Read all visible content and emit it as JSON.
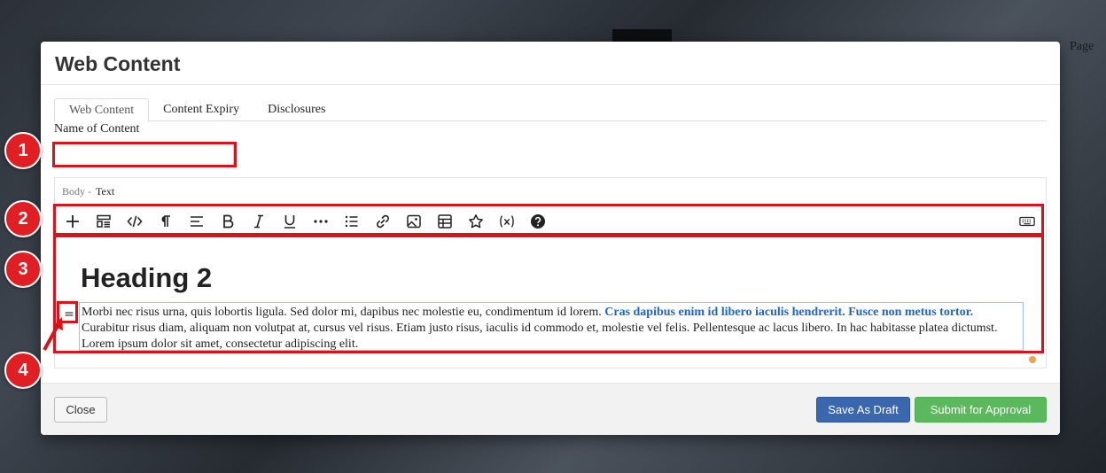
{
  "background": {
    "page_link_text": "Page"
  },
  "modal": {
    "title": "Web Content",
    "tabs": [
      {
        "label": "Web Content",
        "active": true
      },
      {
        "label": "Content Expiry",
        "active": false
      },
      {
        "label": "Disclosures",
        "active": false
      }
    ],
    "name_field": {
      "label": "Name of Content",
      "value": "",
      "placeholder": ""
    },
    "body": {
      "label": "Body -",
      "type": "Text"
    },
    "toolbar": [
      "plus-icon",
      "template-icon",
      "code-icon",
      "paragraph-icon",
      "align-icon",
      "bold-icon",
      "italic-icon",
      "underline-icon",
      "more-icon",
      "list-icon",
      "link-icon",
      "image-icon",
      "table-icon",
      "star-icon",
      "variable-icon",
      "help-icon"
    ],
    "editor": {
      "heading": "Heading 2",
      "paragraph_plain_1": "Morbi nec risus urna, quis lobortis ligula. Sed dolor mi, dapibus nec molestie eu, condimentum id lorem. ",
      "paragraph_link": "Cras dapibus enim id libero iaculis hendrerit. Fusce non metus tortor.",
      "paragraph_plain_2": " Curabitur risus diam, aliquam non volutpat at, cursus vel risus. Etiam justo risus, iaculis id commodo et, molestie vel felis. Pellentesque ac lacus libero. In hac habitasse platea dictumst. Lorem ipsum dolor sit amet, consectetur adipiscing elit.",
      "drag_handle_glyph": "="
    },
    "footer": {
      "close_label": "Close",
      "draft_label": "Save As Draft",
      "submit_label": "Submit for Approval"
    }
  },
  "callouts": [
    "1",
    "2",
    "3",
    "4"
  ],
  "colors": {
    "callout_red": "#e01e23",
    "draft_blue": "#3a67ad",
    "submit_green": "#5cb85c",
    "link_blue": "#1d67c8"
  }
}
